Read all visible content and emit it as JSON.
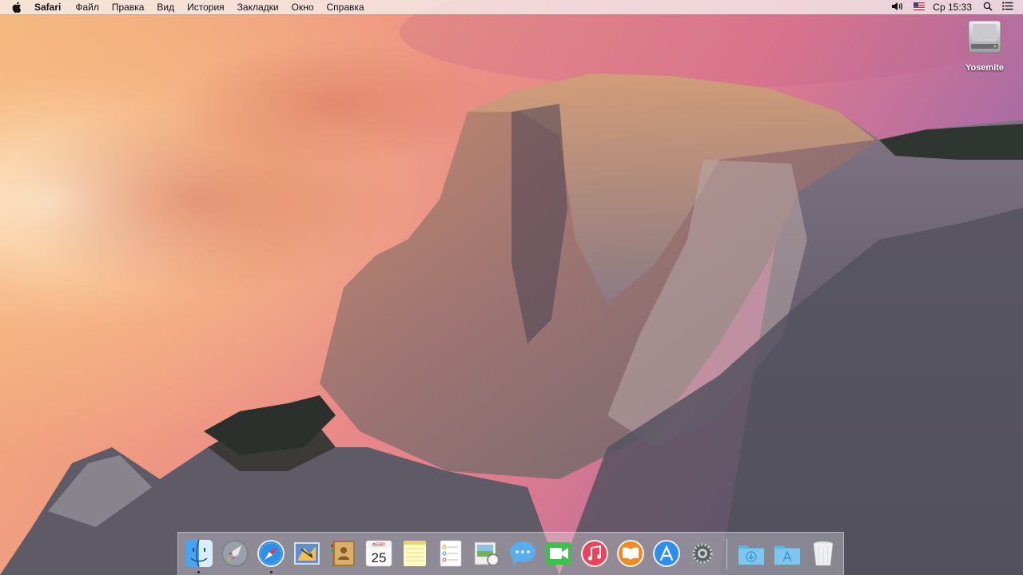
{
  "menubar": {
    "app_name": "Safari",
    "menus": [
      "Файл",
      "Правка",
      "Вид",
      "История",
      "Закладки",
      "Окно",
      "Справка"
    ],
    "clock": "Ср 15:33",
    "status_icons": [
      "volume-icon",
      "us-flag-icon",
      "spotlight-icon",
      "notification-center-icon"
    ]
  },
  "desktop": {
    "wallpaper": "yosemite-half-dome",
    "icons": [
      {
        "label": "Yosemite",
        "icon": "hard-disk-icon"
      }
    ]
  },
  "dock": {
    "items": [
      {
        "name": "Finder",
        "icon": "finder-icon",
        "running": true
      },
      {
        "name": "Launchpad",
        "icon": "launchpad-icon",
        "running": false
      },
      {
        "name": "Safari",
        "icon": "safari-icon",
        "running": true
      },
      {
        "name": "Mail",
        "icon": "mail-icon",
        "running": false
      },
      {
        "name": "Contacts",
        "icon": "contacts-icon",
        "running": false
      },
      {
        "name": "Calendar",
        "icon": "calendar-icon",
        "running": false,
        "month": "ФЕВР.",
        "day": "25"
      },
      {
        "name": "Notes",
        "icon": "notes-icon",
        "running": false
      },
      {
        "name": "Reminders",
        "icon": "reminders-icon",
        "running": false
      },
      {
        "name": "Preview",
        "icon": "preview-icon",
        "running": false
      },
      {
        "name": "Messages",
        "icon": "messages-icon",
        "running": false
      },
      {
        "name": "FaceTime",
        "icon": "facetime-icon",
        "running": false
      },
      {
        "name": "iTunes",
        "icon": "itunes-icon",
        "running": false
      },
      {
        "name": "iBooks",
        "icon": "ibooks-icon",
        "running": false
      },
      {
        "name": "App Store",
        "icon": "app-store-icon",
        "running": false
      },
      {
        "name": "System Preferences",
        "icon": "system-preferences-icon",
        "running": false
      },
      {
        "name": "Downloads",
        "icon": "downloads-folder-icon",
        "running": false
      },
      {
        "name": "Applications",
        "icon": "applications-folder-icon",
        "running": false
      },
      {
        "name": "Trash",
        "icon": "trash-icon",
        "running": false
      }
    ]
  },
  "colors": {
    "menubar_bg": "#f6f0f0",
    "dock_bg": "#dcdce4"
  }
}
